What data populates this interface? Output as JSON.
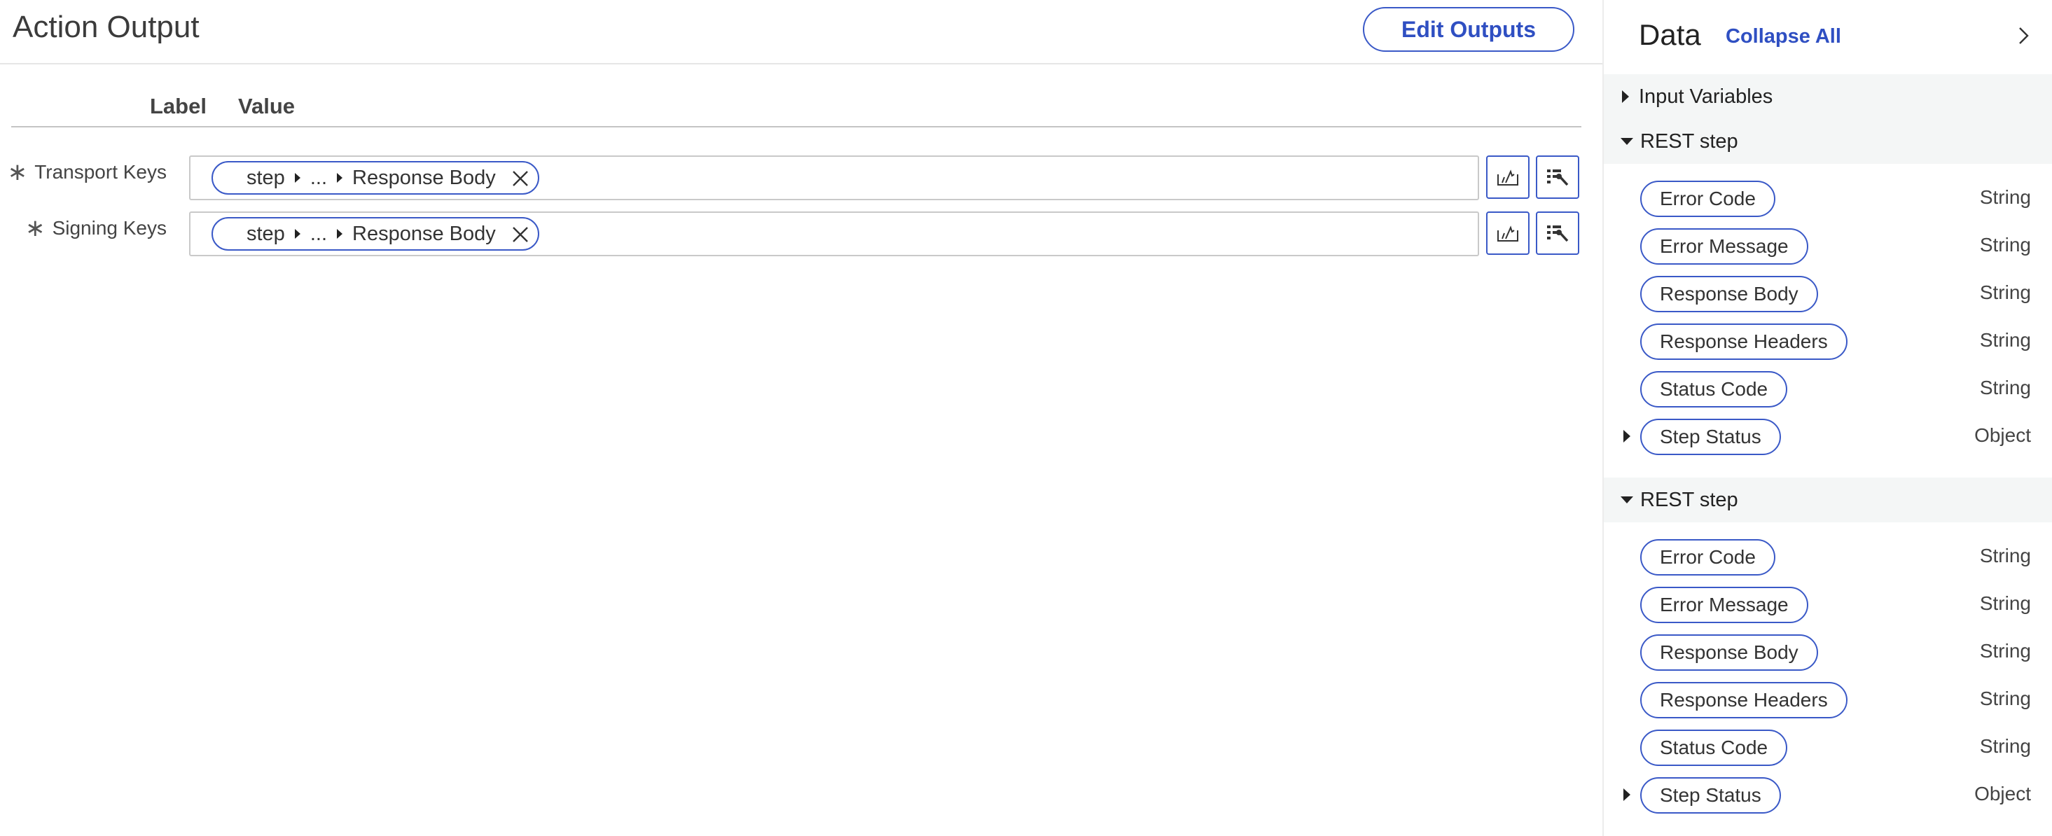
{
  "main": {
    "title": "Action Output",
    "edit_button": "Edit Outputs",
    "columns": {
      "label": "Label",
      "value": "Value"
    },
    "rows": [
      {
        "required_mark": "∗",
        "label": "Transport Keys",
        "pill": {
          "first": "step",
          "middle": "...",
          "last": "Response Body"
        }
      },
      {
        "required_mark": "∗",
        "label": "Signing Keys",
        "pill": {
          "first": "step",
          "middle": "...",
          "last": "Response Body"
        }
      }
    ]
  },
  "side": {
    "title": "Data",
    "collapse_all": "Collapse All",
    "groups": [
      {
        "label": "Input Variables",
        "expanded": false
      },
      {
        "label": "REST step",
        "expanded": true,
        "items": [
          {
            "name": "Error Code",
            "type": "String"
          },
          {
            "name": "Error Message",
            "type": "String"
          },
          {
            "name": "Response Body",
            "type": "String"
          },
          {
            "name": "Response Headers",
            "type": "String"
          },
          {
            "name": "Status Code",
            "type": "String"
          },
          {
            "name": "Step Status",
            "type": "Object",
            "expandable": true
          }
        ]
      },
      {
        "label": "REST step",
        "expanded": true,
        "items": [
          {
            "name": "Error Code",
            "type": "String"
          },
          {
            "name": "Error Message",
            "type": "String"
          },
          {
            "name": "Response Body",
            "type": "String"
          },
          {
            "name": "Response Headers",
            "type": "String"
          },
          {
            "name": "Status Code",
            "type": "String"
          },
          {
            "name": "Step Status",
            "type": "Object",
            "expandable": true
          }
        ]
      }
    ]
  },
  "colors": {
    "accent": "#3a59c7",
    "link": "#2f4fc2",
    "group_bg": "#f4f6f6",
    "border": "#c9c9c9"
  },
  "icons": [
    "close-icon",
    "data-pill-picker-icon",
    "condition-builder-icon",
    "chevron-right-icon",
    "expand-triangle-icon",
    "collapse-triangle-icon"
  ]
}
